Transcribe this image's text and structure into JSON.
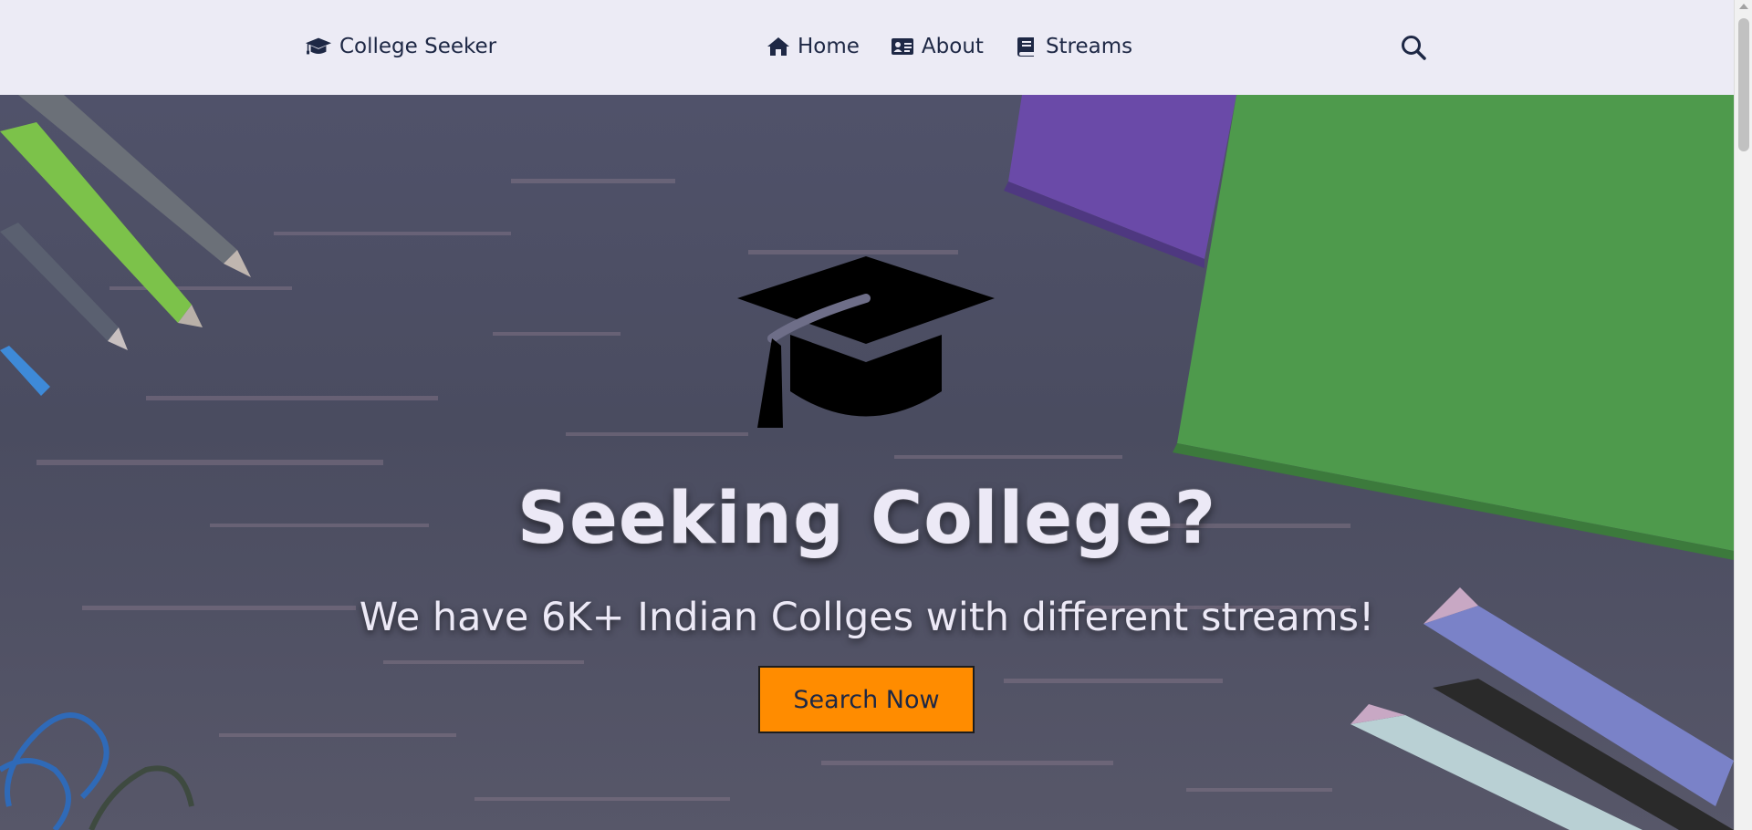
{
  "navbar": {
    "brand_label": "College Seeker",
    "brand_icon": "graduation-cap-icon",
    "links": [
      {
        "label": "Home",
        "icon": "home-icon"
      },
      {
        "label": "About",
        "icon": "id-card-icon"
      },
      {
        "label": "Streams",
        "icon": "book-icon"
      }
    ],
    "search_icon": "search-icon"
  },
  "hero": {
    "icon": "graduation-cap-icon",
    "title": "Seeking College?",
    "subtitle": "We have 6K+ Indian Collges with different streams!",
    "button_label": "Search Now"
  },
  "colors": {
    "navbar_bg": "#ecebf5",
    "nav_text": "#1e2845",
    "accent_button": "#ff8c00",
    "hero_text": "#ece9f6"
  }
}
